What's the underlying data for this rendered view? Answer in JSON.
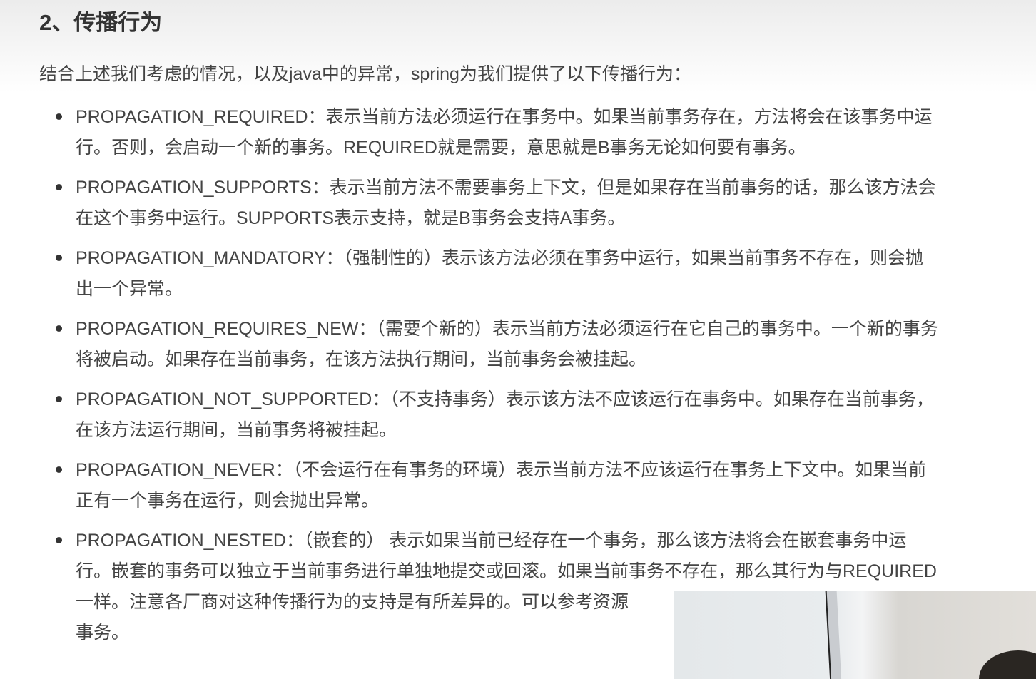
{
  "heading": "2、传播行为",
  "intro": "结合上述我们考虑的情况，以及java中的异常，spring为我们提供了以下传播行为：",
  "items": [
    {
      "lines": [
        "PROPAGATION_REQUIRED：表示当前方法必须运行在事务中。如果当前事务存在，方法将会在该事务中运",
        "行。否则，会启动一个新的事务。REQUIRED就是需要，意思就是B事务无论如何要有事务。"
      ]
    },
    {
      "lines": [
        "PROPAGATION_SUPPORTS：表示当前方法不需要事务上下文，但是如果存在当前事务的话，那么该方法会",
        "在这个事务中运行。SUPPORTS表示支持，就是B事务会支持A事务。"
      ]
    },
    {
      "lines": [
        "PROPAGATION_MANDATORY：（强制性的）表示该方法必须在事务中运行，如果当前事务不存在，则会抛",
        "出一个异常。"
      ]
    },
    {
      "lines": [
        "PROPAGATION_REQUIRES_NEW：（需要个新的）表示当前方法必须运行在它自己的事务中。一个新的事务",
        "将被启动。如果存在当前事务，在该方法执行期间，当前事务会被挂起。"
      ]
    },
    {
      "lines": [
        "PROPAGATION_NOT_SUPPORTED：（不支持事务）表示该方法不应该运行在事务中。如果存在当前事务，",
        "在该方法运行期间，当前事务将被挂起。"
      ]
    },
    {
      "lines": [
        "PROPAGATION_NEVER：（不会运行在有事务的环境）表示当前方法不应该运行在事务上下文中。如果当前",
        "正有一个事务在运行，则会抛出异常。"
      ]
    },
    {
      "lines": [
        "PROPAGATION_NESTED：（嵌套的） 表示如果当前已经存在一个事务，那么该方法将会在嵌套事务中运",
        "行。嵌套的事务可以独立于当前事务进行单独地提交或回滚。如果当前事务不存在，那么其行为与REQUIRED",
        "一样。注意各厂商对这种传播行为的支持是有所差异的。可以参考资源",
        "事务。"
      ]
    }
  ]
}
